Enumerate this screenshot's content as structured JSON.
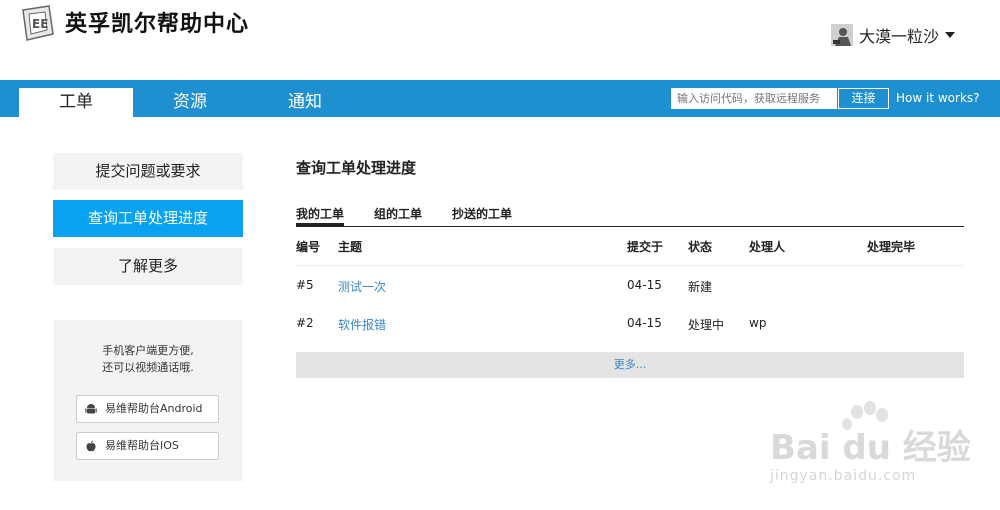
{
  "header": {
    "brand": "英孚凯尔帮助中心",
    "user": {
      "name": "大漠一粒沙"
    }
  },
  "nav": {
    "tabs": [
      {
        "label": "工单",
        "active": true
      },
      {
        "label": "资源",
        "active": false
      },
      {
        "label": "通知",
        "active": false
      }
    ],
    "remote": {
      "placeholder": "输入访问代码，获取远程服务",
      "connect_label": "连接",
      "how_label": "How it works?"
    }
  },
  "sidebar": {
    "items": [
      {
        "label": "提交问题或要求",
        "active": false
      },
      {
        "label": "查询工单处理进度",
        "active": true
      },
      {
        "label": "了解更多",
        "active": false
      }
    ],
    "app_box": {
      "line1": "手机客户端更方便,",
      "line2": "还可以视频通话哦.",
      "android_label": "易维帮助台Android",
      "ios_label": "易维帮助台IOS"
    }
  },
  "main": {
    "title": "查询工单处理进度",
    "subtabs": [
      {
        "label": "我的工单",
        "active": true
      },
      {
        "label": "组的工单",
        "active": false
      },
      {
        "label": "抄送的工单",
        "active": false
      }
    ],
    "table": {
      "headers": [
        "编号",
        "主题",
        "提交于",
        "状态",
        "处理人",
        "处理完毕"
      ],
      "rows": [
        {
          "id": "#5",
          "subject": "测试一次",
          "date": "04-15",
          "status": "新建",
          "handler": "",
          "done": ""
        },
        {
          "id": "#2",
          "subject": "软件报错",
          "date": "04-15",
          "status": "处理中",
          "handler": "wp",
          "done": ""
        }
      ]
    },
    "more_label": "更多..."
  },
  "watermark": {
    "text": "Bai du 经验",
    "url": "jingyan.baidu.com"
  },
  "colors": {
    "nav_blue": "#1e8fcf",
    "active_blue": "#07a2f2",
    "link_blue": "#3a87c8"
  }
}
